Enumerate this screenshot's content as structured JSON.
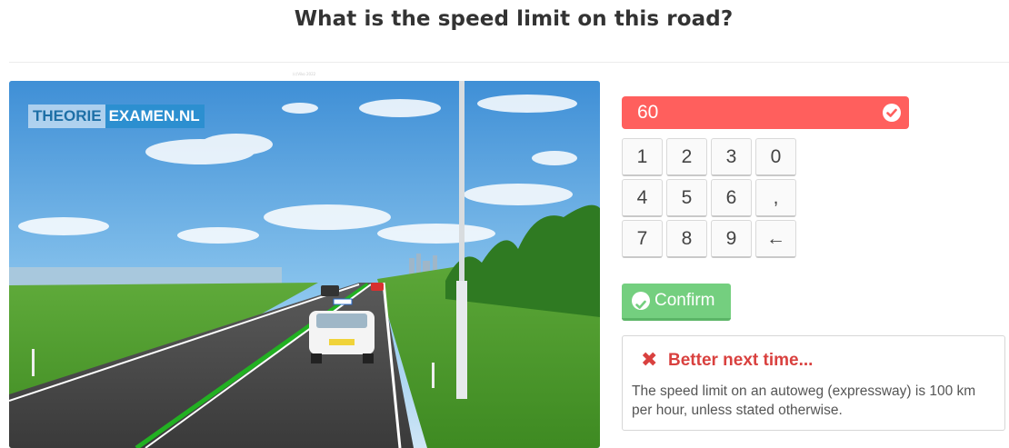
{
  "question": "What is the speed limit on this road?",
  "image_caption": "(c)Viko 2022",
  "logo": {
    "part1": "THEORIE",
    "part2": "EXAMEN.NL"
  },
  "answer": {
    "value": "60"
  },
  "keypad": {
    "keys": [
      "1",
      "2",
      "3",
      "0",
      "4",
      "5",
      "6",
      ",",
      "7",
      "8",
      "9",
      "←"
    ]
  },
  "confirm": {
    "label": "Confirm"
  },
  "feedback": {
    "title": "Better next time...",
    "text": "The speed limit on an autoweg (expressway) is 100 km per hour, unless stated otherwise."
  },
  "colors": {
    "wrong": "#ff5f5d",
    "confirm": "#74cf7f",
    "feedback_title": "#d9413f"
  }
}
